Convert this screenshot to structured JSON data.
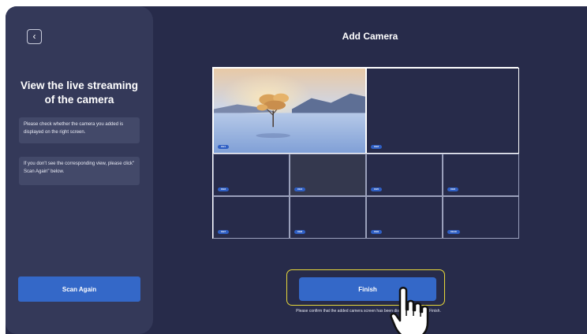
{
  "header": {
    "title": "Add Camera",
    "back_icon": "chevron-left-icon"
  },
  "sidebar": {
    "title_line1": "View the live streaming",
    "title_line2": "of the camera",
    "hint1": "Please check whether the camera you added is displayed on the right screen.",
    "hint2": "If you don't see the corresponding view, please click\" Scan Again\" below.",
    "scan_again_label": "Scan Again"
  },
  "cameras": [
    {
      "label": "CH1",
      "state": "live"
    },
    {
      "label": "CH2",
      "state": "empty"
    },
    {
      "label": "CH3",
      "state": "empty"
    },
    {
      "label": "CH4",
      "state": "no-signal"
    },
    {
      "label": "CH5",
      "state": "empty"
    },
    {
      "label": "CH6",
      "state": "empty"
    },
    {
      "label": "CH7",
      "state": "empty"
    },
    {
      "label": "CH8",
      "state": "empty"
    },
    {
      "label": "CH9",
      "state": "empty"
    },
    {
      "label": "CH10",
      "state": "empty"
    }
  ],
  "footer": {
    "finish_label": "Finish",
    "confirm_text": "Please confirm that the added camera screen has been displayed, and click Finish."
  },
  "colors": {
    "background": "#272b4a",
    "sidebar": "#343959",
    "accent": "#3468c8",
    "highlight": "#e8d83a"
  }
}
